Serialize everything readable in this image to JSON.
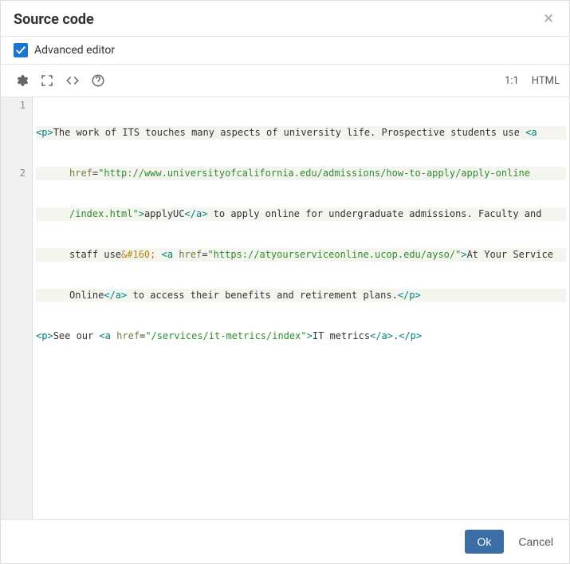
{
  "dialog": {
    "title": "Source code",
    "close_label": "×"
  },
  "advanced": {
    "label": "Advanced editor",
    "checked": true
  },
  "toolbar": {
    "ratio": "1:1",
    "language": "HTML"
  },
  "gutter": {
    "line1": "1",
    "line2": "2"
  },
  "code": {
    "line1": {
      "seg1_tag": "<p>",
      "seg2_text": "The work of ITS touches many aspects of university life. Prospective students use ",
      "seg3_tag": "<a",
      "seg4_wrap_attr": "href",
      "seg4b_eq": "=",
      "seg5_str": "\"http://www.universityofcalifornia.edu/admissions/how-to-apply/apply-online",
      "seg6_str2": "/index.html\"",
      "seg6b_tagclose": ">",
      "seg7_text": "applyUC",
      "seg8_tag": "</a>",
      "seg9_text": " to apply online for undergraduate admissions. Faculty and",
      "seg10_text": "staff use",
      "seg11_ent": "&#160;",
      "seg11b_space": " ",
      "seg12_tag": "<a",
      "seg12b_space": " ",
      "seg13_attr": "href",
      "seg13b_eq": "=",
      "seg14_str": "\"https://atyourserviceonline.ucop.edu/ayso/\"",
      "seg14b_tagclose": ">",
      "seg15_text": "At Your Service",
      "seg16_text": "Online",
      "seg17_tag": "</a>",
      "seg18_text": " to access their benefits and retirement plans.",
      "seg19_tag": "</p>"
    },
    "line2": {
      "seg1_tag": "<p>",
      "seg2_text": "See our ",
      "seg3_tag": "<a",
      "seg3b_space": " ",
      "seg4_attr": "href",
      "seg4b_eq": "=",
      "seg5_str": "\"/services/it-metrics/index\"",
      "seg5b_tagclose": ">",
      "seg6_text": "IT metrics",
      "seg7_tag": "</a>",
      "seg8_text": ".",
      "seg9_tag": "</p>"
    }
  },
  "footer": {
    "ok": "Ok",
    "cancel": "Cancel"
  }
}
